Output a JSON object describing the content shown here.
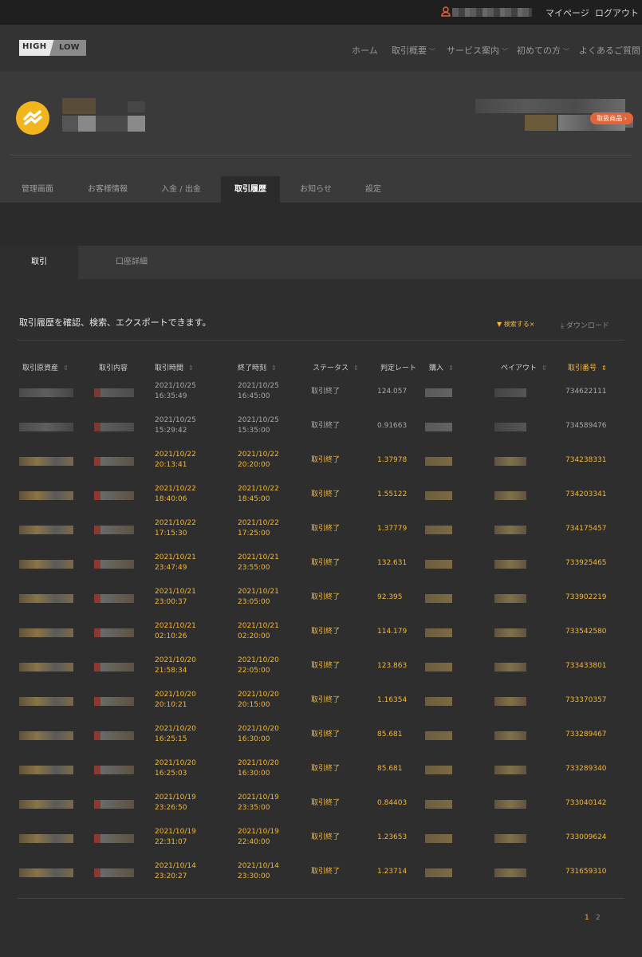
{
  "topbar": {
    "mypage": "マイページ",
    "logout": "ログアウト"
  },
  "header": {
    "logo_high": "HIGH",
    "logo_low": "LOW",
    "nav": [
      "ホーム",
      "取引概要",
      "サービス案内",
      "初めての方",
      "よくあるご質問"
    ]
  },
  "tabs": [
    "管理画面",
    "お客様情報",
    "入金 / 出金",
    "取引履歴",
    "お知らせ",
    "設定"
  ],
  "badge": "取扱商品",
  "subtabs": [
    "取引",
    "口座詳細"
  ],
  "intro": "取引履歴を確認、検索、エクスポートできます。",
  "search_label": "検索する",
  "download_label": "ダウンロード",
  "columns": [
    "取引原資産",
    "取引内容",
    "取引時間",
    "終了時刻",
    "ステータス",
    "判定レート",
    "購入",
    "ペイアウト",
    "取引番号"
  ],
  "rows": [
    {
      "start_date": "2021/10/25",
      "start_time": "16:35:49",
      "end_date": "2021/10/25",
      "end_time": "16:45:00",
      "status": "取引終了",
      "rate": "124.057",
      "id": "734622111",
      "highlight": false
    },
    {
      "start_date": "2021/10/25",
      "start_time": "15:29:42",
      "end_date": "2021/10/25",
      "end_time": "15:35:00",
      "status": "取引終了",
      "rate": "0.91663",
      "id": "734589476",
      "highlight": false
    },
    {
      "start_date": "2021/10/22",
      "start_time": "20:13:41",
      "end_date": "2021/10/22",
      "end_time": "20:20:00",
      "status": "取引終了",
      "rate": "1.37978",
      "id": "734238331",
      "highlight": true
    },
    {
      "start_date": "2021/10/22",
      "start_time": "18:40:06",
      "end_date": "2021/10/22",
      "end_time": "18:45:00",
      "status": "取引終了",
      "rate": "1.55122",
      "id": "734203341",
      "highlight": true
    },
    {
      "start_date": "2021/10/22",
      "start_time": "17:15:30",
      "end_date": "2021/10/22",
      "end_time": "17:25:00",
      "status": "取引終了",
      "rate": "1.37779",
      "id": "734175457",
      "highlight": true
    },
    {
      "start_date": "2021/10/21",
      "start_time": "23:47:49",
      "end_date": "2021/10/21",
      "end_time": "23:55:00",
      "status": "取引終了",
      "rate": "132.631",
      "id": "733925465",
      "highlight": true
    },
    {
      "start_date": "2021/10/21",
      "start_time": "23:00:37",
      "end_date": "2021/10/21",
      "end_time": "23:05:00",
      "status": "取引終了",
      "rate": "92.395",
      "id": "733902219",
      "highlight": true
    },
    {
      "start_date": "2021/10/21",
      "start_time": "02:10:26",
      "end_date": "2021/10/21",
      "end_time": "02:20:00",
      "status": "取引終了",
      "rate": "114.179",
      "id": "733542580",
      "highlight": true
    },
    {
      "start_date": "2021/10/20",
      "start_time": "21:58:34",
      "end_date": "2021/10/20",
      "end_time": "22:05:00",
      "status": "取引終了",
      "rate": "123.863",
      "id": "733433801",
      "highlight": true
    },
    {
      "start_date": "2021/10/20",
      "start_time": "20:10:21",
      "end_date": "2021/10/20",
      "end_time": "20:15:00",
      "status": "取引終了",
      "rate": "1.16354",
      "id": "733370357",
      "highlight": true
    },
    {
      "start_date": "2021/10/20",
      "start_time": "16:25:15",
      "end_date": "2021/10/20",
      "end_time": "16:30:00",
      "status": "取引終了",
      "rate": "85.681",
      "id": "733289467",
      "highlight": true
    },
    {
      "start_date": "2021/10/20",
      "start_time": "16:25:03",
      "end_date": "2021/10/20",
      "end_time": "16:30:00",
      "status": "取引終了",
      "rate": "85.681",
      "id": "733289340",
      "highlight": true
    },
    {
      "start_date": "2021/10/19",
      "start_time": "23:26:50",
      "end_date": "2021/10/19",
      "end_time": "23:35:00",
      "status": "取引終了",
      "rate": "0.84403",
      "id": "733040142",
      "highlight": true
    },
    {
      "start_date": "2021/10/19",
      "start_time": "22:31:07",
      "end_date": "2021/10/19",
      "end_time": "22:40:00",
      "status": "取引終了",
      "rate": "1.23653",
      "id": "733009624",
      "highlight": true
    },
    {
      "start_date": "2021/10/14",
      "start_time": "23:20:27",
      "end_date": "2021/10/14",
      "end_time": "23:30:00",
      "status": "取引終了",
      "rate": "1.23714",
      "id": "731659310",
      "highlight": true
    }
  ],
  "pages": [
    "1",
    "2"
  ],
  "colors": {
    "accent": "#f5b731",
    "badge": "#e2643a",
    "avatar": "#f2b51d"
  }
}
